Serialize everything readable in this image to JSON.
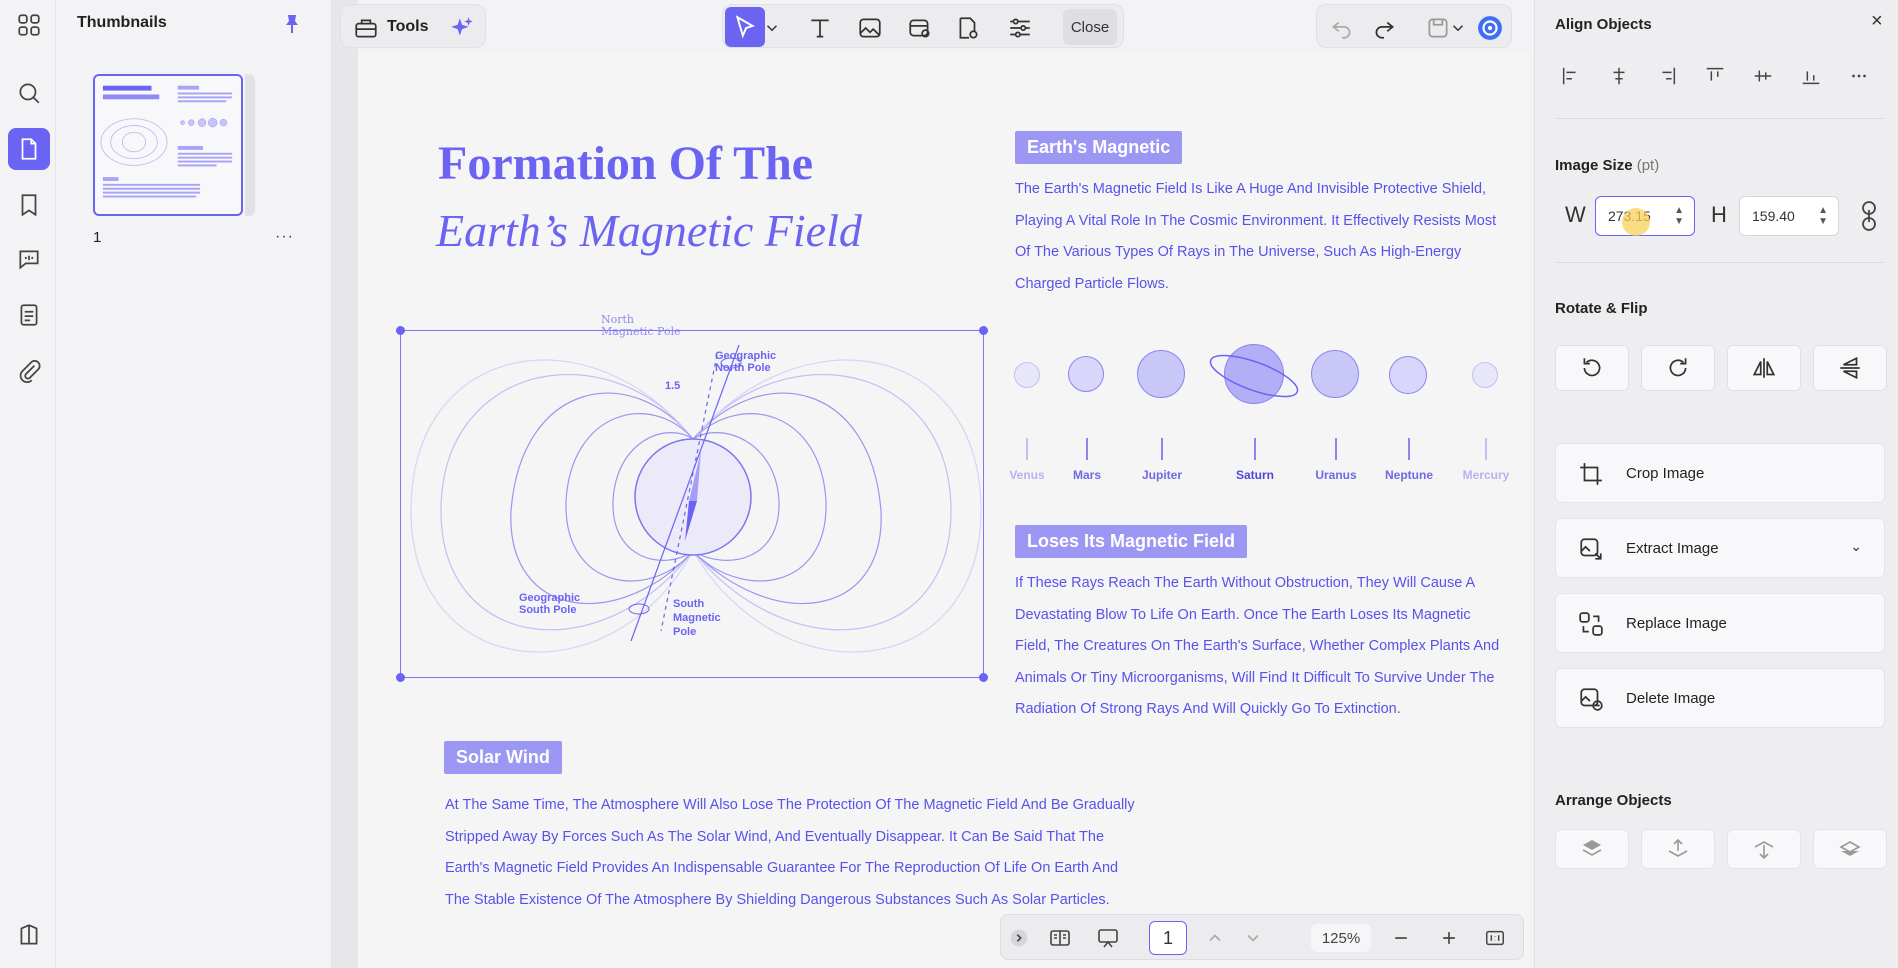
{
  "thumbnails": {
    "title": "Thumbnails",
    "page_number": "1",
    "more": "···"
  },
  "toolbar": {
    "tools_label": "Tools",
    "close_label": "Close"
  },
  "document": {
    "title_line1": "Formation Of The",
    "title_line2": "Earth’s Magnetic Field",
    "section1_tag": "Earth's Magnetic",
    "section1_lines": [
      "The Earth's Magnetic Field Is Like A Huge And Invisible Protective Shield,",
      "Playing A Vital Role In The Cosmic Environment. It Effectively Resists Most",
      "Of The Various Types Of Rays in The Universe, Such As High-Energy",
      "Charged Particle Flows."
    ],
    "section2_tag": "Loses Its Magnetic Field",
    "section2_lines": [
      "If These Rays Reach The Earth Without Obstruction, They Will Cause A",
      "Devastating Blow To Life On Earth. Once The Earth Loses Its Magnetic",
      "Field, The Creatures On The Earth's Surface, Whether Complex Plants And",
      "Animals Or Tiny Microorganisms, Will Find It Difficult To Survive Under The",
      "Radiation Of Strong Rays And Will Quickly Go To Extinction."
    ],
    "section3_tag": "Solar Wind",
    "section3_lines": [
      "At The Same Time, The Atmosphere Will Also Lose The Protection Of The Magnetic Field And Be Gradually",
      "Stripped Away By Forces Such As The Solar Wind, And Eventually Disappear. It Can Be Said That The",
      "Earth's Magnetic Field Provides An Indispensable Guarantee For The Reproduction Of Life On Earth And",
      "The Stable Existence Of The Atmosphere By Shielding Dangerous Substances Such As Solar Particles."
    ],
    "diagram": {
      "north_magnetic_pole": [
        "North",
        "Magnetic Pole"
      ],
      "geographic_north_pole": [
        "Geographic",
        "North Pole"
      ],
      "geographic_south_pole": [
        "Geographic",
        "South Pole"
      ],
      "south_magnetic_pole": [
        "South",
        "Magnetic",
        "Pole"
      ],
      "angle": "1.5"
    },
    "planets": [
      "Venus",
      "Mars",
      "Jupiter",
      "Saturn",
      "Uranus",
      "Neptune",
      "Mercury"
    ]
  },
  "bottombar": {
    "page": "1",
    "zoom": "125%"
  },
  "right_panel": {
    "align_title": "Align Objects",
    "size_title": "Image Size",
    "size_unit": "(pt)",
    "w_label": "W",
    "w_value": "273.15",
    "h_label": "H",
    "h_value": "159.40",
    "rotate_title": "Rotate & Flip",
    "crop_label": "Crop Image",
    "extract_label": "Extract Image",
    "replace_label": "Replace Image",
    "delete_label": "Delete Image",
    "arrange_title": "Arrange Objects"
  },
  "colors": {
    "accent": "#6b63f2",
    "doc_text": "#5a52e8",
    "tag_bg": "#9d97f4"
  }
}
